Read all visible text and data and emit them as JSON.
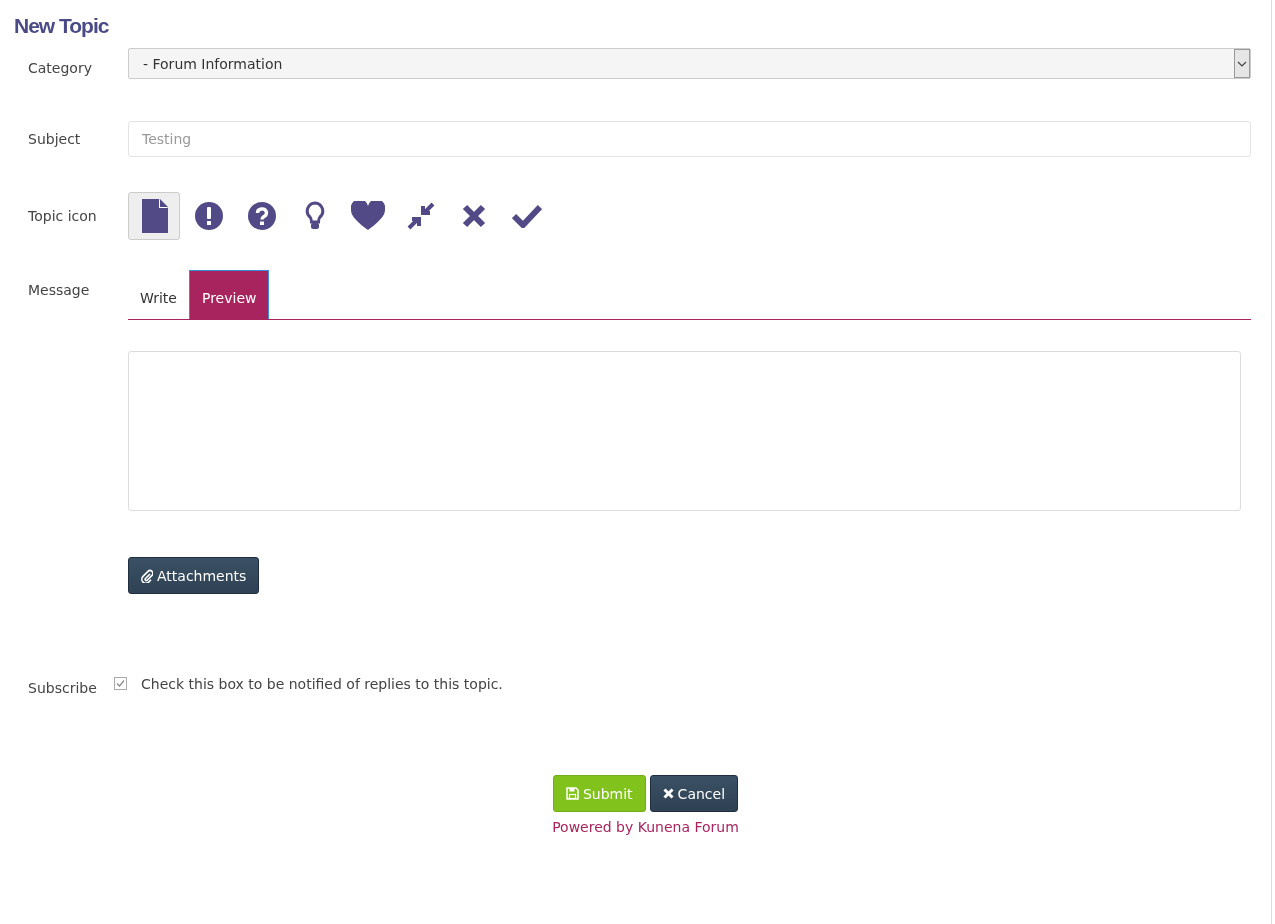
{
  "title": "New Topic",
  "category": {
    "label": "Category",
    "value": "- Forum Information"
  },
  "subject": {
    "label": "Subject",
    "placeholder": "Testing"
  },
  "topic_icon": {
    "label": "Topic icon",
    "icons": [
      {
        "kind": "file",
        "selected": true
      },
      {
        "kind": "exclamation",
        "selected": false
      },
      {
        "kind": "question",
        "selected": false
      },
      {
        "kind": "bulb",
        "selected": false
      },
      {
        "kind": "heart",
        "selected": false
      },
      {
        "kind": "compress",
        "selected": false
      },
      {
        "kind": "cross",
        "selected": false
      },
      {
        "kind": "check",
        "selected": false
      }
    ]
  },
  "message": {
    "label": "Message",
    "tabs": [
      {
        "label": "Write",
        "selected": false
      },
      {
        "label": "Preview",
        "selected": true
      }
    ]
  },
  "attachments_button": "Attachments",
  "subscribe": {
    "label": "Subscribe",
    "checked": true,
    "text": "Check this box to be notified of replies to this topic."
  },
  "buttons": [
    {
      "kind": "submit",
      "label": "Submit"
    },
    {
      "kind": "cancel",
      "label": "Cancel"
    }
  ],
  "footer": "Powered by Kunena Forum"
}
